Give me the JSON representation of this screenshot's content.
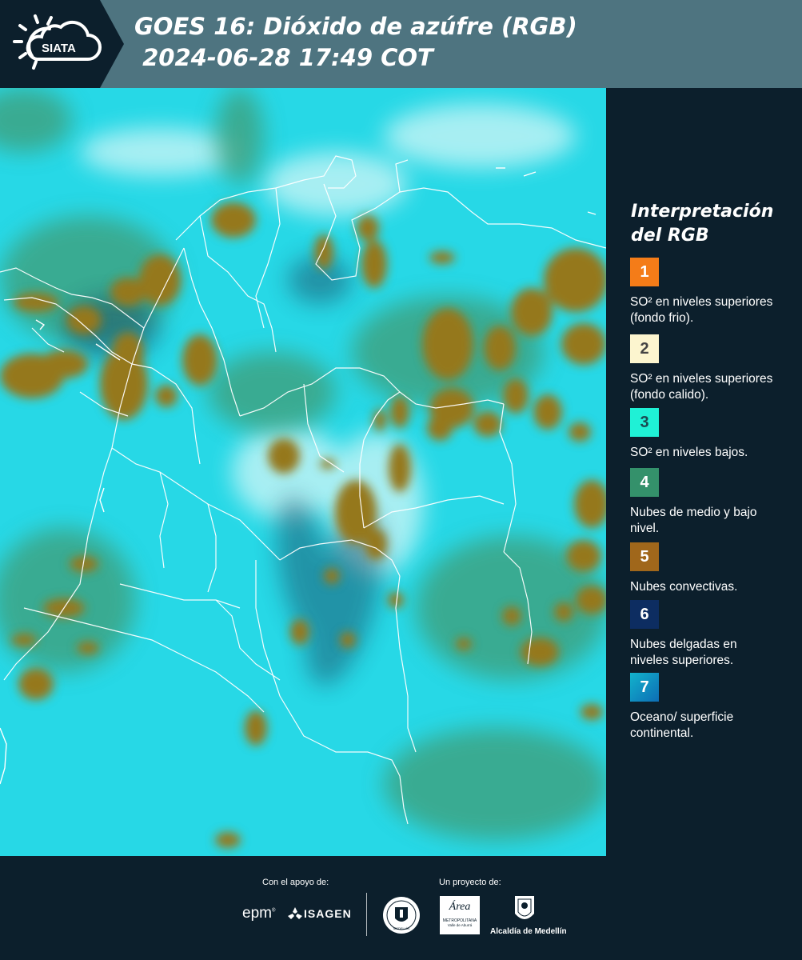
{
  "header": {
    "logo_text": "SIATA",
    "title_line1": "GOES 16: Dióxido de azúfre (RGB)",
    "title_line2": " 2024-06-28 17:49 COT"
  },
  "legend": {
    "title": "Interpretación del RGB",
    "items": [
      {
        "number": "1",
        "color": "#f47c18",
        "text_color": "#ffffff",
        "description": "SO² en niveles superiores (fondo frio)."
      },
      {
        "number": "2",
        "color": "#fcf5cf",
        "text_color": "#444444",
        "description": "SO² en niveles superiores (fondo calido)."
      },
      {
        "number": "3",
        "color": "#1ff1d6",
        "text_color": "#1b4a52",
        "description": "SO² en niveles bajos."
      },
      {
        "number": "4",
        "color": "#34916b",
        "text_color": "#ffffff",
        "description": "Nubes de medio y bajo nivel."
      },
      {
        "number": "5",
        "color": "#a0671b",
        "text_color": "#ffffff",
        "description": "Nubes convectivas."
      },
      {
        "number": "6",
        "color": "#0d2d61",
        "text_color": "#ffffff",
        "description": "Nubes delgadas en niveles superiores."
      },
      {
        "number": "7",
        "color": "#0f8cc8",
        "text_color": "#ffffff",
        "description": "Oceano/ superficie continental."
      }
    ]
  },
  "map": {
    "background_color": "#27d8e6",
    "cloud_color": "#93781d",
    "border_color": "#ffffff"
  },
  "footer": {
    "support_label": "Con el apoyo de:",
    "project_label": "Un proyecto de:",
    "sponsors": {
      "epm": "epm",
      "isagen": "ISAGEN",
      "area_name": "Área",
      "area_line1": "METROPOLITANA",
      "area_line2": "Valle de Aburrá",
      "alcaldia": "Alcaldía de Medellín",
      "medellin_seal": "MEDELLÍN"
    }
  }
}
